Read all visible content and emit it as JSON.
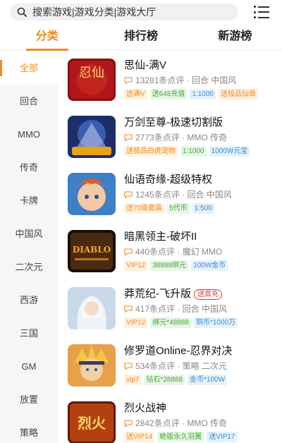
{
  "search": {
    "placeholder": "搜索游戏|游戏分类|游戏大厅"
  },
  "tabs": [
    {
      "label": "分类",
      "active": true
    },
    {
      "label": "排行榜",
      "active": false
    },
    {
      "label": "新游榜",
      "active": false
    }
  ],
  "sidebar": {
    "items": [
      {
        "label": "全部",
        "active": true
      },
      {
        "label": "回合"
      },
      {
        "label": "MMO"
      },
      {
        "label": "传奇"
      },
      {
        "label": "卡牌"
      },
      {
        "label": "中国风"
      },
      {
        "label": "二次元"
      },
      {
        "label": "西游"
      },
      {
        "label": "三国"
      },
      {
        "label": "GM"
      },
      {
        "label": "放置"
      },
      {
        "label": "策略"
      }
    ]
  },
  "games": [
    {
      "title": "思仙-满V",
      "meta": "13281条点评 · 回合 中国风",
      "tags": [
        {
          "text": "送满V",
          "color": "orange"
        },
        {
          "text": "送648充值",
          "color": "green"
        },
        {
          "text": "1:1000",
          "color": "blue"
        },
        {
          "text": "送极品仙兽",
          "color": "orange"
        }
      ]
    },
    {
      "title": "万剑至尊-极速切割版",
      "meta": "2773条点评 · MMO 传奇",
      "tags": [
        {
          "text": "送极品白虎宠物",
          "color": "orange"
        },
        {
          "text": "1:1000",
          "color": "green"
        },
        {
          "text": "1000W元宝",
          "color": "blue"
        }
      ]
    },
    {
      "title": "仙语奇缘-超级特权",
      "meta": "1245条点评 · 回合 中国风",
      "tags": [
        {
          "text": "送70级套装",
          "color": "orange"
        },
        {
          "text": "5代币",
          "color": "green"
        },
        {
          "text": "1:500",
          "color": "blue"
        }
      ]
    },
    {
      "title": "暗黑领主-破坏II",
      "meta": "440条点评 · 魔幻 MMO",
      "tags": [
        {
          "text": "VIP12",
          "color": "orange"
        },
        {
          "text": "38888绑元",
          "color": "green"
        },
        {
          "text": "100W金币",
          "color": "blue"
        }
      ]
    },
    {
      "title": "莽荒纪-飞升版",
      "badge": "送首充",
      "meta": "417条点评 · 回合 中国风",
      "tags": [
        {
          "text": "VIP12",
          "color": "orange"
        },
        {
          "text": "绑元*48888",
          "color": "green"
        },
        {
          "text": "铜币*1000万",
          "color": "blue"
        }
      ]
    },
    {
      "title": "修罗道Online-忍界对决",
      "meta": "534条点评 · 策略 二次元",
      "tags": [
        {
          "text": "vip7",
          "color": "orange"
        },
        {
          "text": "钻石*28888",
          "color": "green"
        },
        {
          "text": "金币*100W",
          "color": "blue"
        }
      ]
    },
    {
      "title": "烈火战神",
      "meta": "2842条点评 · MMO 传奇",
      "tags": [
        {
          "text": "送VIP14",
          "color": "orange"
        },
        {
          "text": "绝版永久羽翼",
          "color": "green"
        },
        {
          "text": "送VIP17",
          "color": "blue"
        }
      ]
    }
  ],
  "icon_text": {
    "g1": "忍仙",
    "g4": "DIABLO",
    "g7": "烈火"
  },
  "colors": {
    "accent": "#f28a1e",
    "hot_badge": "#e23a3a"
  }
}
